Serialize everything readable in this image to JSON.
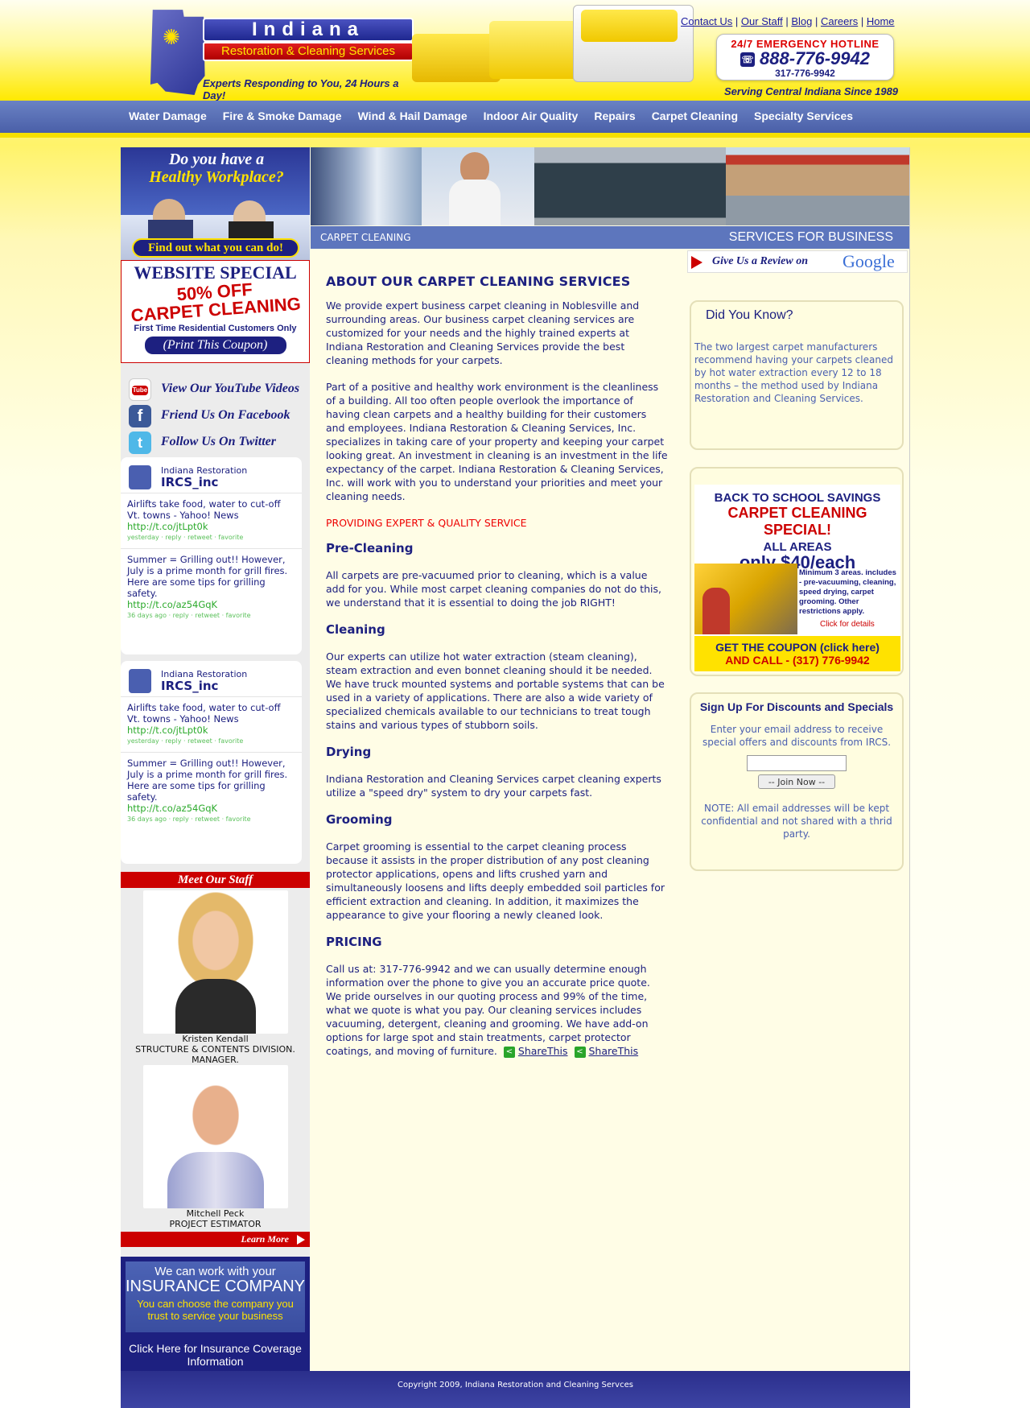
{
  "logo": {
    "title": "Indiana",
    "subtitle": "Restoration & Cleaning Services",
    "tagline": "Experts Responding to You,  24 Hours a Day!"
  },
  "top_links": [
    "Contact Us",
    "Our Staff",
    "Blog",
    "Careers",
    "Home"
  ],
  "hotline": {
    "title": "24/7 EMERGENCY HOTLINE",
    "number": "888-776-9942",
    "alt_number": "317-776-9942"
  },
  "serving": "Serving Central Indiana Since 1989",
  "nav": [
    "Water Damage",
    "Fire & Smoke Damage",
    "Wind & Hail Damage",
    "Indoor Air Quality",
    "Repairs",
    "Carpet Cleaning",
    "Specialty Services"
  ],
  "left": {
    "workplace_title_1": "Do you have a",
    "workplace_title_2": "Healthy Workplace?",
    "workplace_cta": "Find out what you can do!",
    "coupon_heading": "WEBSITE SPECIAL",
    "coupon_offer_1": "50% OFF",
    "coupon_offer_2": "CARPET CLEANING",
    "coupon_fine": "First Time Residential Customers Only",
    "coupon_print": "(Print This Coupon)",
    "social": [
      {
        "icon": "youtube-icon",
        "label": "View Our YouTube Videos"
      },
      {
        "icon": "facebook-icon",
        "label": "Friend Us On Facebook"
      },
      {
        "icon": "twitter-icon",
        "label": "Follow Us On Twitter"
      }
    ],
    "twitter": {
      "org": "Indiana Restoration",
      "user": "IRCS_inc",
      "tweets": [
        {
          "text": "Airlifts take food, water to cut-off Vt. towns - Yahoo! News",
          "link": "http://t.co/jtLpt0k",
          "meta": "yesterday · reply · retweet · favorite"
        },
        {
          "text": "Summer = Grilling out!! However, July is a prime month for grill fires. Here are some tips for grilling safety.",
          "link": "http://t.co/az54GqK",
          "meta": "36 days ago · reply · retweet · favorite"
        }
      ]
    },
    "staff_heading": "Meet Our Staff",
    "staff": [
      {
        "name": "Kristen Kendall",
        "title": "STRUCTURE & CONTENTS DIVISION. MANAGER."
      },
      {
        "name": "Mitchell Peck",
        "title": "PROJECT ESTIMATOR"
      }
    ],
    "learn_more": "Learn More",
    "insurance_1": "We can work with your",
    "insurance_2": "INSURANCE COMPANY",
    "insurance_3": "You can choose the company you trust to service your business",
    "insurance_click": "Click Here for Insurance Coverage Information"
  },
  "section_bar": {
    "left": "CARPET CLEANING",
    "right": "SERVICES FOR BUSINESS"
  },
  "main": {
    "heading": "ABOUT OUR CARPET CLEANING SERVICES",
    "p1": "We provide expert business carpet cleaning in Noblesville and surrounding areas. Our business carpet cleaning services are customized for your needs and the highly trained experts at Indiana Restoration and Cleaning Services provide the best cleaning methods for your carpets.",
    "p2": "Part of a positive and healthy work environment is the cleanliness of a building. All too often people overlook the importance of having clean carpets and a healthy building for their customers and employees. Indiana Restoration & Cleaning Services, Inc. specializes in taking care of your property and keeping your carpet looking great. An investment in cleaning is an investment in the life expectancy of the carpet. Indiana Restoration & Cleaning Services, Inc. will work with you to understand your priorities and meet your cleaning needs.",
    "red_line": "PROVIDING EXPERT & QUALITY SERVICE",
    "h_pre": "Pre-Cleaning",
    "p_pre": "All carpets are pre-vacuumed prior to cleaning, which is a value add for you. While most carpet cleaning companies do not do this, we understand that it is essential to doing the job RIGHT!",
    "h_clean": "Cleaning",
    "p_clean": "Our experts can utilize hot water extraction (steam cleaning), steam extraction and even bonnet cleaning should it be needed. We have truck mounted systems and portable systems that can be used in a variety of applications. There are also a wide variety of specialized chemicals available to our technicians to treat tough stains and various types of stubborn soils.",
    "h_dry": "Drying",
    "p_dry": "Indiana Restoration and Cleaning Services carpet cleaning experts utilize a \"speed dry\" system to dry your carpets fast.",
    "h_groom": "Grooming",
    "p_groom": "Carpet grooming is essential to the carpet cleaning process because it assists in the proper distribution of any post cleaning protector applications, opens and lifts crushed yarn and simultaneously loosens and lifts deeply embedded soil particles for efficient extraction and cleaning. In addition, it maximizes the appearance to give your flooring a newly cleaned look.",
    "h_price": "PRICING",
    "p_price": "Call us at: 317-776-9942 and we can usually determine enough information over the phone to give you an accurate price quote. We pride ourselves in our quoting process and 99% of the time, what we quote is what you pay. Our cleaning services includes vacuuming, detergent, cleaning and grooming. We have add-on options for large spot and stain treatments, carpet protector coatings, and moving of furniture.",
    "share": "ShareThis"
  },
  "right": {
    "review_label": "Give Us a Review on",
    "review_brand": "Google",
    "dyk_title": "Did You Know?",
    "dyk_body": "The two largest carpet manufacturers recommend having your carpets cleaned by hot water extraction every 12 to 18 months – the method used by Indiana Restoration and Cleaning Services.",
    "promo_1": "BACK TO SCHOOL SAVINGS",
    "promo_2": "CARPET CLEANING SPECIAL!",
    "promo_3": "ALL AREAS",
    "promo_4": "only $40/each",
    "promo_fine": "Minimum 3 areas. includes - pre-vacuuming, cleaning, speed drying, carpet grooming. Other restrictions apply.",
    "promo_click": "Click for details",
    "promo_cta_1": "GET THE COUPON (click here)",
    "promo_cta_2": "AND CALL - (317) 776-9942",
    "signup_title": "Sign Up For Discounts and Specials",
    "signup_text": "Enter your email address to receive special offers and discounts from IRCS.",
    "signup_button": "-- Join Now --",
    "signup_note": "NOTE: All email addresses will be kept confidential and not shared with a thrid party."
  },
  "footer": "Copyright 2009, Indiana Restoration and Cleaning Servces"
}
